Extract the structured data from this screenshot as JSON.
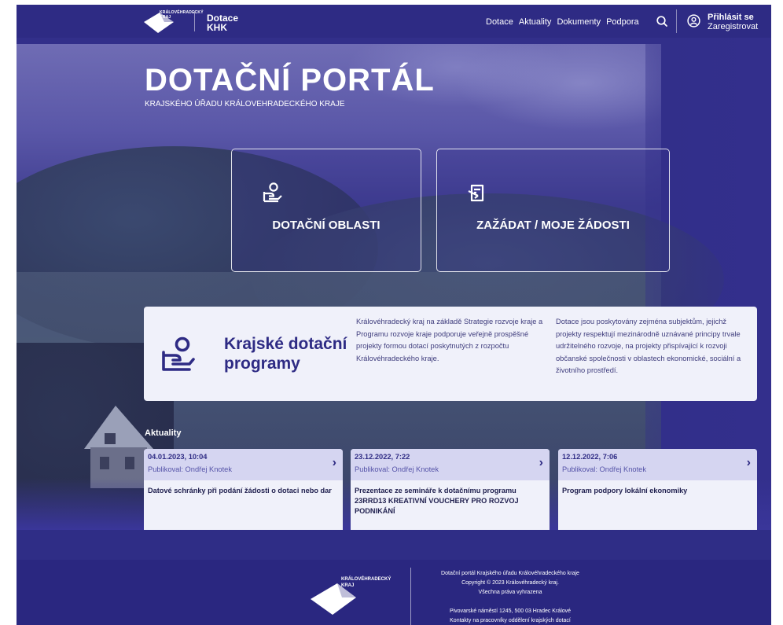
{
  "header": {
    "logo_small_line1": "KRÁLOVÉHRADECKÝ",
    "logo_small_line2": "KRAJ",
    "brand_line1": "Dotace",
    "brand_line2": "KHK",
    "nav": [
      "Dotace",
      "Aktuality",
      "Dokumenty",
      "Podpora"
    ],
    "login": "Přihlásit se",
    "register": "Zaregistrovat"
  },
  "hero": {
    "title": "DOTAČNÍ PORTÁL",
    "subtitle": "KRAJSKÉHO ÚŘADU KRÁLOVEHRADECKÉHO KRAJE",
    "tiles": [
      {
        "label": "DOTAČNÍ OBLASTI",
        "icon": "hand-person-icon"
      },
      {
        "label": "ZAŽÁDAT / MOJE ŽÁDOSTI",
        "icon": "document-pen-icon"
      }
    ]
  },
  "info": {
    "title": "Krajské dotační programy",
    "text1": "Královéhradecký kraj na základě Strategie rozvoje kraje a Programu rozvoje kraje podporuje veřejně prospěšné projekty formou dotací poskytnutých z rozpočtu Královéhradeckého kraje.",
    "text2": "Dotace jsou poskytovány zejména subjektům, jejichž projekty respektují mezinárodně uznávané principy trvale udržitelného rozvoje, na projekty přispívající k rozvoji občanské společnosti v oblastech ekonomické, sociální a životního prostředí."
  },
  "news": {
    "heading": "Aktuality",
    "items": [
      {
        "date": "04.01.2023, 10:04",
        "author": "Publikoval: Ondřej Knotek",
        "title": "Datové schránky při podání žádosti o dotaci nebo dar"
      },
      {
        "date": "23.12.2022, 7:22",
        "author": "Publikoval: Ondřej Knotek",
        "title": "Prezentace ze semináře k dotačnímu programu 23RRD13 KREATIVNÍ VOUCHERY PRO ROZVOJ PODNIKÁNÍ"
      },
      {
        "date": "12.12.2022, 7:06",
        "author": "Publikoval: Ondřej Knotek",
        "title": "Program podpory lokální ekonomiky"
      }
    ]
  },
  "footer": {
    "logo_line1": "KRÁLOVÉHRADECKÝ",
    "logo_line2": "KRAJ",
    "line1": "Dotační portál Krajského úřadu Královéhradeckého kraje",
    "line2": "Copyright © 2023 Královéhradecký kraj.",
    "line3": "Všechna práva vyhrazena",
    "line4": "Pivovarské náměstí 1245, 500 03 Hradec Králové",
    "line5": "Kontakty na pracovníky oddělení krajských dotací"
  }
}
